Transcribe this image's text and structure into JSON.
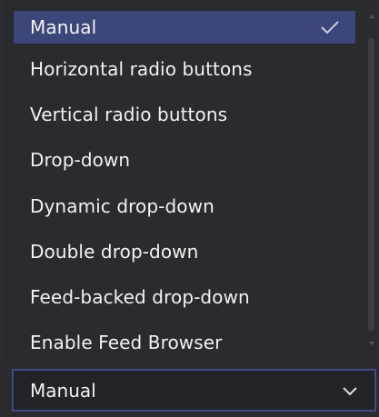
{
  "dropdown": {
    "selected_index": 0,
    "options": [
      "Manual",
      "Horizontal radio buttons",
      "Vertical radio buttons",
      "Drop-down",
      "Dynamic drop-down",
      "Double drop-down",
      "Feed-backed drop-down",
      "Enable Feed Browser"
    ]
  },
  "select": {
    "value": "Manual"
  },
  "icons": {
    "checkmark": "checkmark-icon",
    "chevron": "chevron-down-icon",
    "scroll_up": "scroll-up-arrow-icon",
    "scroll_down": "scroll-down-arrow-icon"
  },
  "colors": {
    "selected_bg": "#3d4679",
    "text": "#f2f2f2",
    "focus_border": "#3d4a86",
    "list_bg": "#2a2b2f"
  }
}
